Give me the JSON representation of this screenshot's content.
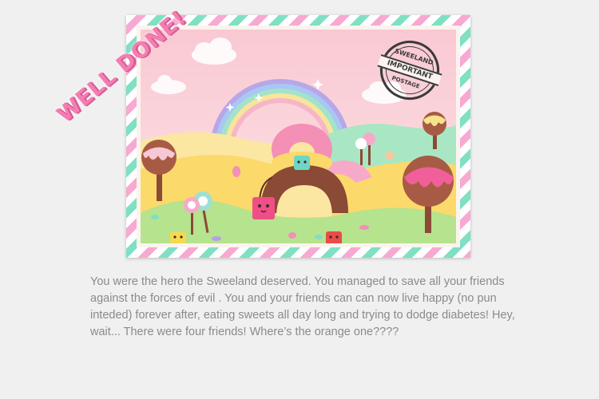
{
  "banner": {
    "title": "WELL DONE!"
  },
  "stamp": {
    "top_text": "SWEELAND",
    "middle_text": "IMPORTANT",
    "bottom_text": "POSTAGE"
  },
  "story": {
    "text": "You were the hero the Sweeland deserved. You managed to save all your friends against the forces of evil . You and your friends can can now live happy (no pun inteded) forever after, eating sweets all day long and trying to dodge diabetes! Hey, wait... There were four friends! Where’s the orange one????"
  },
  "colors": {
    "page_background": "#f0f0f0",
    "title_pink": "#f47eb1",
    "text_gray": "#8a8a8a",
    "stripe_pink": "#f7a9d2",
    "stripe_mint": "#7fe0c3",
    "sky_pink": "#fbd3dc"
  },
  "characters": [
    {
      "name": "pink-cube-friend",
      "color": "#ef4f86"
    },
    {
      "name": "teal-cube-friend",
      "color": "#6fd6c4"
    },
    {
      "name": "red-cube-friend",
      "color": "#ea4b48"
    },
    {
      "name": "yellow-cube-friend",
      "color": "#f7d94c"
    }
  ]
}
